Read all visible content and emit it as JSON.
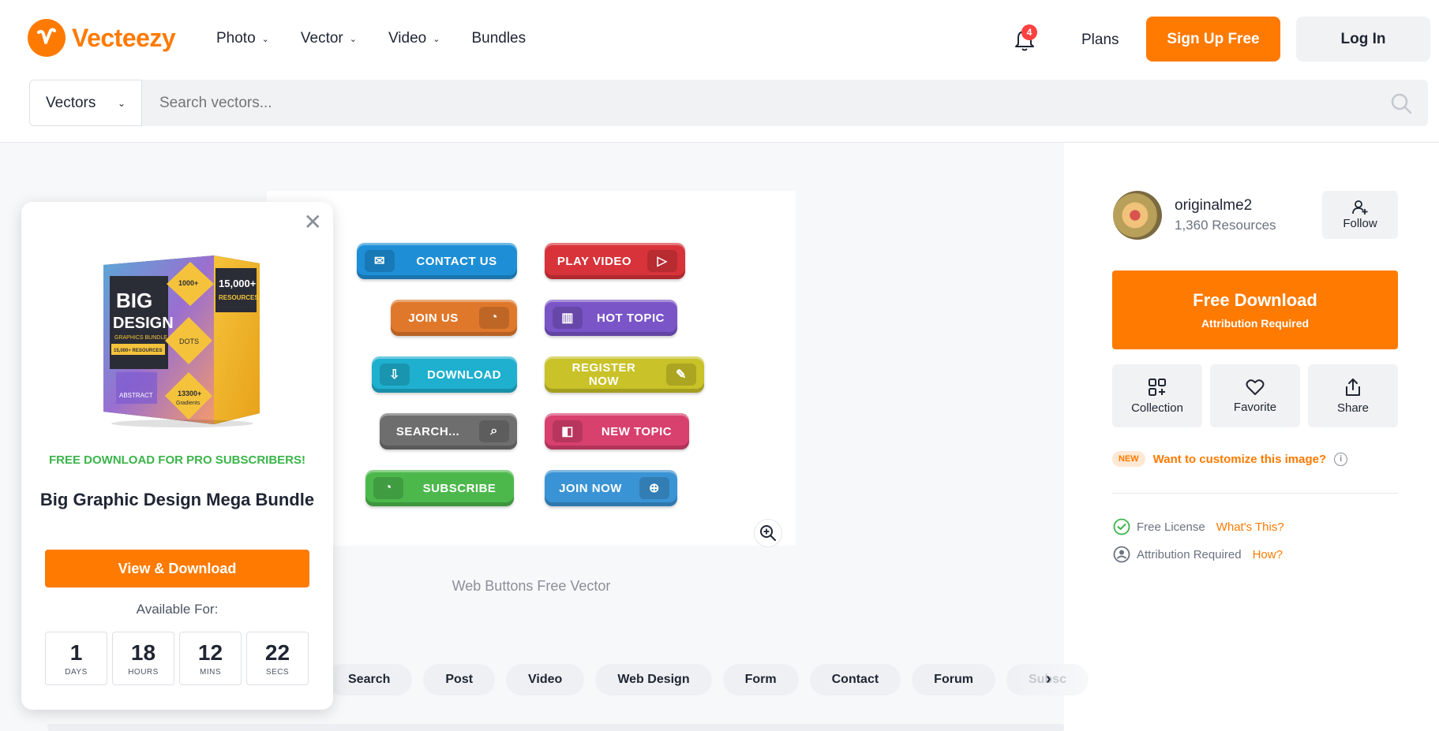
{
  "header": {
    "logo_text": "Vecteezy",
    "nav": [
      {
        "label": "Photo",
        "has_dropdown": true
      },
      {
        "label": "Vector",
        "has_dropdown": true
      },
      {
        "label": "Video",
        "has_dropdown": true
      },
      {
        "label": "Bundles",
        "has_dropdown": false
      }
    ],
    "notification_count": "4",
    "plans_label": "Plans",
    "signup_label": "Sign Up Free",
    "login_label": "Log In"
  },
  "search": {
    "type_label": "Vectors",
    "placeholder": "Search vectors..."
  },
  "preview": {
    "caption": "Web Buttons Free Vector",
    "buttons": [
      {
        "label": "CONTACT US",
        "color": "#1e8fd6"
      },
      {
        "label": "PLAY VIDEO",
        "color": "#d8333a"
      },
      {
        "label": "JOIN US",
        "color": "#e0782c"
      },
      {
        "label": "HOT TOPIC",
        "color": "#7a55c7"
      },
      {
        "label": "DOWNLOAD",
        "color": "#1fb0cf"
      },
      {
        "label": "REGISTER NOW",
        "color": "#c9c228"
      },
      {
        "label": "SEARCH...",
        "color": "#6e6e6e"
      },
      {
        "label": "NEW TOPIC",
        "color": "#d8406e"
      },
      {
        "label": "SUBSCRIBE",
        "color": "#4cb84c"
      },
      {
        "label": "JOIN NOW",
        "color": "#3a93d4"
      }
    ]
  },
  "tags": [
    "Search",
    "Post",
    "Video",
    "Web Design",
    "Form",
    "Contact",
    "Forum",
    "Subsc"
  ],
  "promo": {
    "kicker": "FREE DOWNLOAD FOR PRO SUBSCRIBERS!",
    "title": "Big Graphic Design Mega Bundle",
    "button_label": "View & Download",
    "available_label": "Available For:",
    "countdown": [
      {
        "value": "1",
        "unit": "DAYS"
      },
      {
        "value": "18",
        "unit": "HOURS"
      },
      {
        "value": "12",
        "unit": "MINS"
      },
      {
        "value": "22",
        "unit": "SECS"
      }
    ],
    "box_art": {
      "big": "BIG",
      "design": "DESIGN",
      "sub": "GRAPHICS BUNDLE",
      "resources_tag": "15,000+ RESOURCES",
      "corner": "15,000+",
      "corner_sub": "RESOURCES",
      "dots": "DOTS",
      "abstract": "ABSTRACT",
      "gradients": "13300+",
      "gradients_sub": "Gradients",
      "swatches": "1000+"
    }
  },
  "sidebar": {
    "author_name": "originalme2",
    "author_resources": "1,360 Resources",
    "follow_label": "Follow",
    "free_download_label": "Free Download",
    "attribution_label": "Attribution Required",
    "actions": [
      "Collection",
      "Favorite",
      "Share"
    ],
    "new_badge": "NEW",
    "customize_label": "Want to customize this image?",
    "license_label": "Free License",
    "license_link": "What's This?",
    "attribution_row_label": "Attribution Required",
    "attribution_link": "How?"
  },
  "colors": {
    "accent": "#ff7a00",
    "promo_green": "#3bb54a",
    "badge_red": "#ff4040"
  }
}
